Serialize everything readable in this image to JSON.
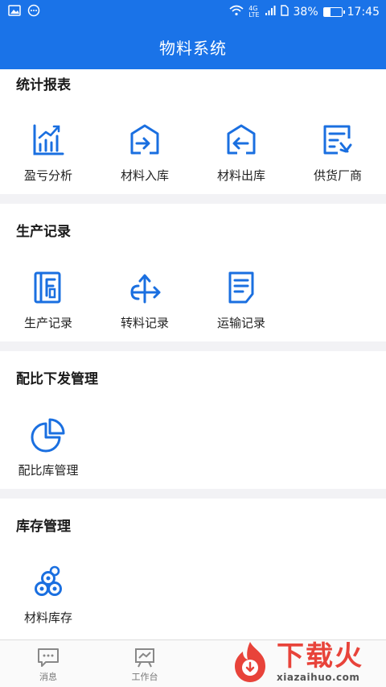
{
  "status_bar": {
    "network_label_top": "4G",
    "network_label_bottom": "LTE",
    "battery_percent": "38%",
    "battery_level": 0.38,
    "time": "17:45"
  },
  "header": {
    "title": "物料系统"
  },
  "sections": [
    {
      "title": "统计报表",
      "items": [
        {
          "label": "盈亏分析",
          "icon": "bar-chart-icon"
        },
        {
          "label": "材料入库",
          "icon": "warehouse-in-icon"
        },
        {
          "label": "材料出库",
          "icon": "warehouse-out-icon"
        },
        {
          "label": "供货厂商",
          "icon": "supplier-doc-icon"
        }
      ]
    },
    {
      "title": "生产记录",
      "items": [
        {
          "label": "生产记录",
          "icon": "production-book-icon"
        },
        {
          "label": "转料记录",
          "icon": "transfer-arrows-icon"
        },
        {
          "label": "运输记录",
          "icon": "document-lines-icon"
        }
      ]
    },
    {
      "title": "配比下发管理",
      "items": [
        {
          "label": "配比库管理",
          "icon": "pie-chart-icon"
        }
      ]
    },
    {
      "title": "库存管理",
      "items": [
        {
          "label": "材料库存",
          "icon": "stacked-pipes-icon"
        }
      ]
    }
  ],
  "bottom_nav": [
    {
      "label": "消息",
      "icon": "message-icon"
    },
    {
      "label": "工作台",
      "icon": "workbench-icon"
    }
  ],
  "watermark": {
    "text": "下载火",
    "url": "xiazaihuo.com"
  },
  "colors": {
    "primary": "#1a73e8",
    "watermark": "#e8433a"
  }
}
